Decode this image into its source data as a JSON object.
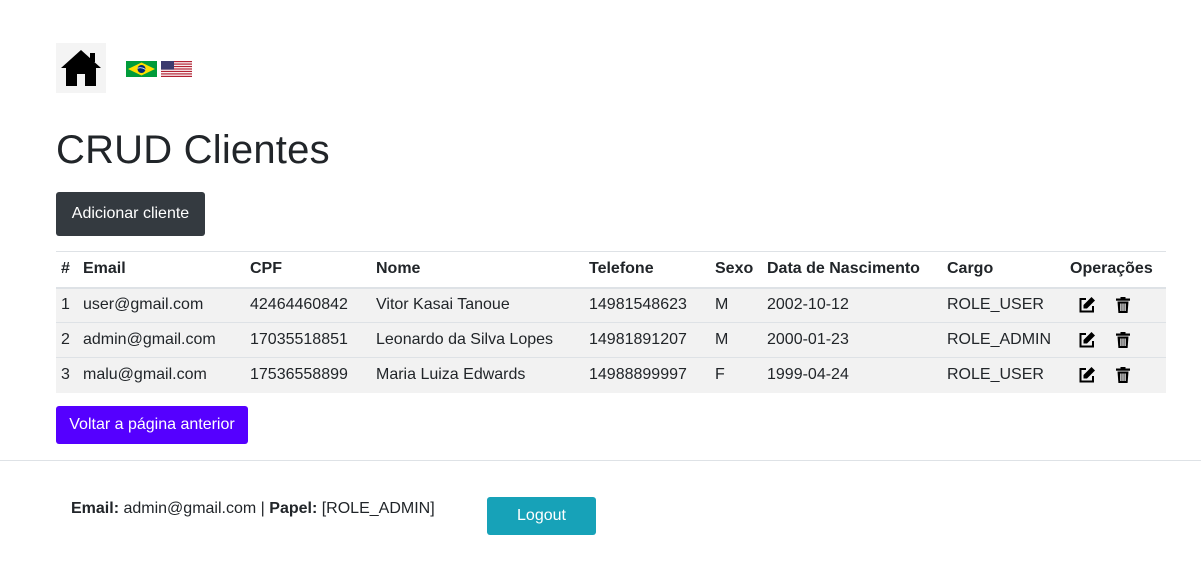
{
  "nav": {
    "home_icon": "home-icon",
    "flags": [
      {
        "name": "brazil-flag-icon",
        "lang": "pt-BR"
      },
      {
        "name": "usa-flag-icon",
        "lang": "en-US"
      }
    ]
  },
  "page": {
    "title": "CRUD Clientes",
    "add_button": "Adicionar cliente",
    "back_button": "Voltar a página anterior"
  },
  "table": {
    "headers": [
      "#",
      "Email",
      "CPF",
      "Nome",
      "Telefone",
      "Sexo",
      "Data de Nascimento",
      "Cargo",
      "Operações"
    ],
    "rows": [
      {
        "id": "1",
        "email": "user@gmail.com",
        "cpf": "42464460842",
        "nome": "Vitor Kasai Tanoue",
        "telefone": "14981548623",
        "sexo": "M",
        "nascimento": "2002-10-12",
        "cargo": "ROLE_USER"
      },
      {
        "id": "2",
        "email": "admin@gmail.com",
        "cpf": "17035518851",
        "nome": "Leonardo da Silva Lopes",
        "telefone": "14981891207",
        "sexo": "M",
        "nascimento": "2000-01-23",
        "cargo": "ROLE_ADMIN"
      },
      {
        "id": "3",
        "email": "malu@gmail.com",
        "cpf": "17536558899",
        "nome": "Maria Luiza Edwards",
        "telefone": "14988899997",
        "sexo": "F",
        "nascimento": "1999-04-24",
        "cargo": "ROLE_USER"
      }
    ],
    "op_icons": [
      "edit-icon",
      "trash-icon"
    ]
  },
  "footer": {
    "email_label": "Email:",
    "email_value": "admin@gmail.com",
    "separator": "|",
    "role_label": "Papel:",
    "role_value": "[ROLE_ADMIN]",
    "logout_button": "Logout"
  },
  "colors": {
    "add_button": "#343a40",
    "back_button": "#5500ff",
    "logout_button": "#17a2b8",
    "row_background": "#f2f2f2"
  }
}
